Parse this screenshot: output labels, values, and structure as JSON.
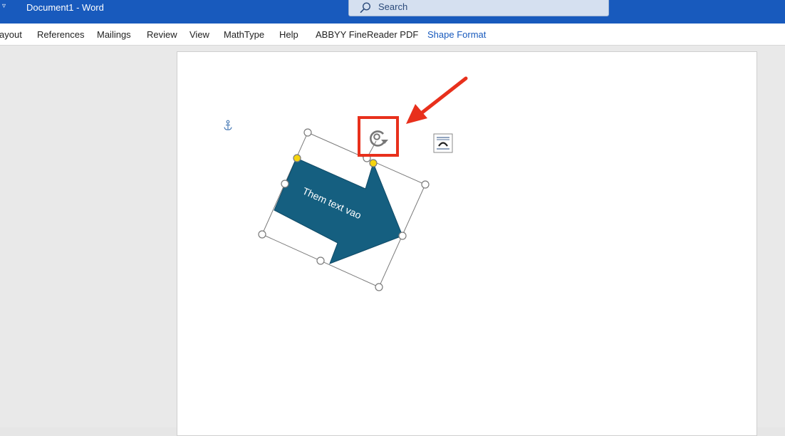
{
  "titlebar": {
    "document_title": "Document1  -  Word",
    "search_placeholder": "Search",
    "qat_glyph": "▿"
  },
  "ribbon": {
    "tabs": [
      {
        "label": "ayout"
      },
      {
        "label": "References"
      },
      {
        "label": "Mailings"
      },
      {
        "label": "Review"
      },
      {
        "label": "View"
      },
      {
        "label": "MathType"
      },
      {
        "label": "Help"
      },
      {
        "label": "ABBYY FineReader PDF"
      },
      {
        "label": "Shape Format",
        "active": true
      }
    ]
  },
  "shape": {
    "type": "block-arrow",
    "text": "Them text vao",
    "fill_color": "#155f80",
    "text_color": "#ffffff"
  },
  "annotation": {
    "color": "#e8301c",
    "target": "rotate-handle"
  },
  "icons": {
    "anchor": "anchor-icon",
    "rotate": "rotate-handle-icon",
    "layout_options": "layout-options-icon",
    "search": "search-icon"
  }
}
